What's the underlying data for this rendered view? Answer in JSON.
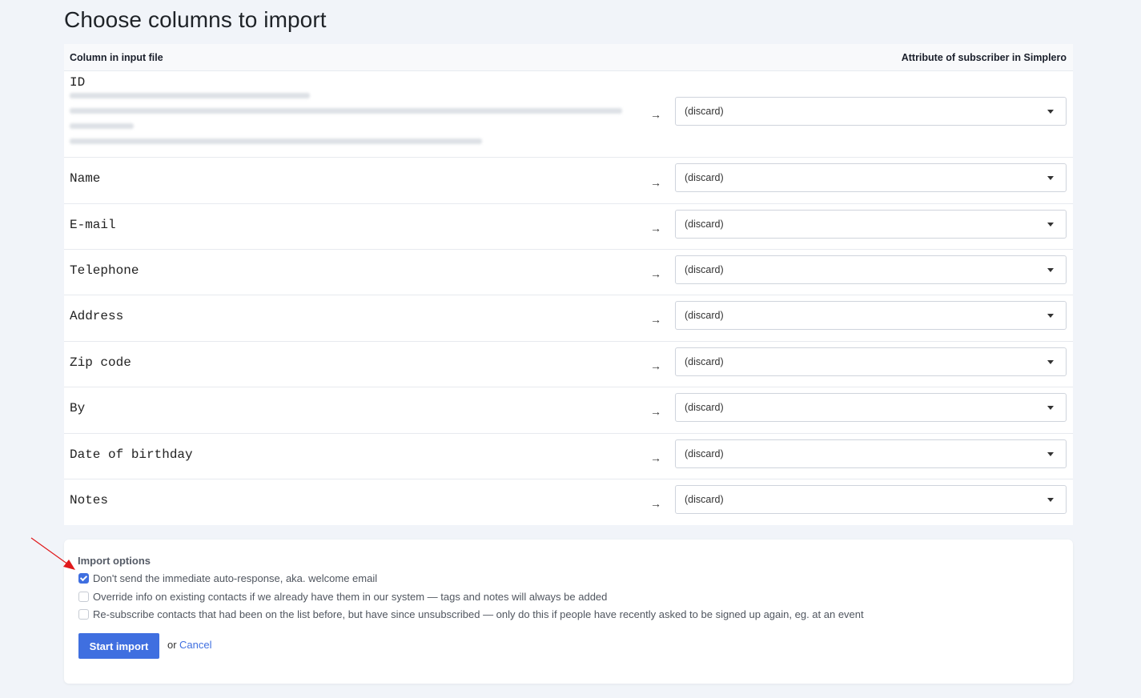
{
  "page_title": "Choose columns to import",
  "table": {
    "header_left": "Column in input file",
    "header_right": "Attribute of subscriber in Simplero",
    "arrow": "→",
    "rows": [
      {
        "name": "ID",
        "selected": "(discard)"
      },
      {
        "name": "Name",
        "selected": "(discard)"
      },
      {
        "name": "E-mail",
        "selected": "(discard)"
      },
      {
        "name": "Telephone",
        "selected": "(discard)"
      },
      {
        "name": "Address",
        "selected": "(discard)"
      },
      {
        "name": "Zip code",
        "selected": "(discard)"
      },
      {
        "name": "By",
        "selected": "(discard)"
      },
      {
        "name": "Date of birthday",
        "selected": "(discard)"
      },
      {
        "name": "Notes",
        "selected": "(discard)"
      }
    ]
  },
  "import_options": {
    "title": "Import options",
    "options": [
      {
        "label": "Don't send the immediate auto-response, aka. welcome email",
        "checked": true
      },
      {
        "label": "Override info on existing contacts if we already have them in our system — tags and notes will always be added",
        "checked": false
      },
      {
        "label": "Re-subscribe contacts that had been on the list before, but have since unsubscribed — only do this if people have recently asked to be signed up again, eg. at an event",
        "checked": false
      }
    ],
    "start_label": "Start import",
    "or_text": "or",
    "cancel_label": "Cancel"
  },
  "colors": {
    "accent": "#3f6fe0",
    "annotation_arrow": "#e0191b"
  }
}
